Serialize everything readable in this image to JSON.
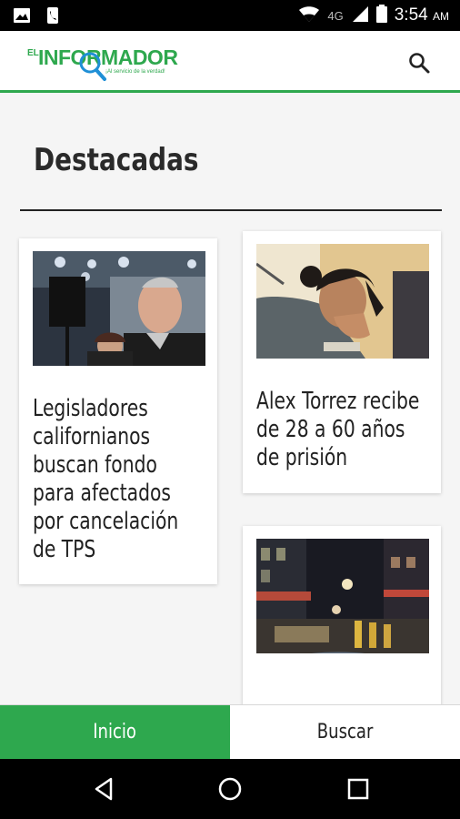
{
  "status_bar": {
    "time": "3:54",
    "ampm": "AM",
    "network": "4G",
    "icons": [
      "image-notification-icon",
      "phone-notification-icon",
      "wifi-icon",
      "signal-icon",
      "battery-icon"
    ]
  },
  "app_bar": {
    "logo_el": "EL",
    "logo_word": "INFORMADOR",
    "logo_tagline": "¡Al servicio de la verdad!",
    "search_icon": "search-icon"
  },
  "section": {
    "title": "Destacadas"
  },
  "articles": [
    {
      "headline": "Legisladores californianos buscan fondo para afectados por cancelación de TPS",
      "image": "photo-politician-at-event"
    },
    {
      "headline": "Alex Torrez recibe de 28 a 60 años de prisión",
      "image": "photo-man-praying-in-court"
    },
    {
      "headline": "",
      "image": "photo-firefighters-night-street"
    }
  ],
  "bottom_nav": {
    "tabs": [
      {
        "label": "Inicio",
        "active": true
      },
      {
        "label": "Buscar",
        "active": false
      }
    ]
  },
  "system_nav": {
    "buttons": [
      "back-icon",
      "home-icon",
      "recents-icon"
    ]
  },
  "colors": {
    "brand_green": "#2ea84e",
    "logo_blue": "#1f8fd6"
  }
}
